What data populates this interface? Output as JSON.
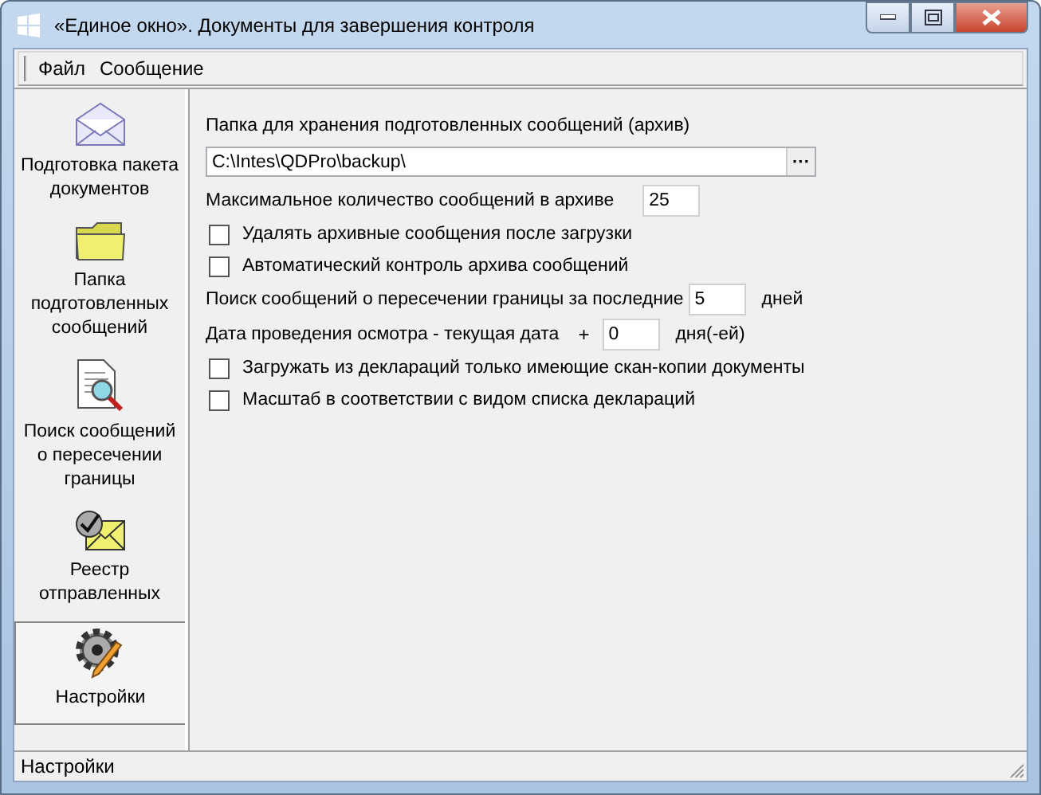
{
  "window": {
    "title": "«Единое окно». Документы для завершения контроля"
  },
  "menu": [
    "Файл",
    "Сообщение"
  ],
  "sidebar": {
    "items": [
      {
        "label": "Подготовка пакета документов",
        "selected": false
      },
      {
        "label": "Папка подготовленных сообщений",
        "selected": false
      },
      {
        "label": "Поиск сообщений о пересечении границы",
        "selected": false
      },
      {
        "label": "Реестр отправленных",
        "selected": false
      },
      {
        "label": "Настройки",
        "selected": true
      }
    ]
  },
  "settings": [
    {
      "kind": "label",
      "text": "Папка для хранения подготовленных сообщений (архив)"
    },
    {
      "kind": "path",
      "value": "C:\\Intes\\QDPro\\backup\\",
      "button": "···"
    },
    {
      "kind": "number",
      "label": "Максимальное количество сообщений в архиве",
      "value": "25"
    },
    {
      "kind": "checkbox",
      "label": "Удалять архивные сообщения после загрузки",
      "checked": false
    },
    {
      "kind": "checkbox",
      "label": "Автоматический контроль архива сообщений",
      "checked": false
    },
    {
      "kind": "number",
      "label": "Поиск сообщений о пересечении границы за последние",
      "value": "5",
      "suffix": "дней"
    },
    {
      "kind": "number",
      "label": "Дата проведения осмотра - текущая дата",
      "operator": "+",
      "value": "0",
      "suffix": "дня(-ей)"
    },
    {
      "kind": "checkbox",
      "label": "Загружать из деклараций только имеющие скан-копии документы",
      "checked": false
    },
    {
      "kind": "checkbox",
      "label": "Масштаб в соответствии с видом списка деклараций",
      "checked": false
    }
  ],
  "status_bar": {
    "text": "Настройки"
  }
}
